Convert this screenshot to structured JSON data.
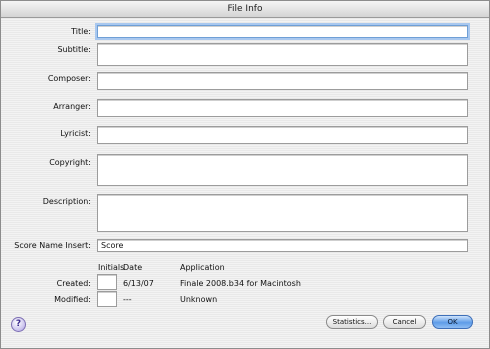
{
  "window": {
    "title": "File Info"
  },
  "fields": {
    "title": {
      "label": "Title:",
      "value": ""
    },
    "subtitle": {
      "label": "Subtitle:",
      "value": ""
    },
    "composer": {
      "label": "Composer:",
      "value": ""
    },
    "arranger": {
      "label": "Arranger:",
      "value": ""
    },
    "lyricist": {
      "label": "Lyricist:",
      "value": ""
    },
    "copyright": {
      "label": "Copyright:",
      "value": ""
    },
    "description": {
      "label": "Description:",
      "value": ""
    },
    "score_name_insert": {
      "label": "Score Name Insert:",
      "value": "Score"
    }
  },
  "history": {
    "headers": {
      "initials": "Initials",
      "date": "Date",
      "application": "Application"
    },
    "created": {
      "label": "Created:",
      "initials": "",
      "date": "6/13/07",
      "application": "Finale 2008.b34 for Macintosh"
    },
    "modified": {
      "label": "Modified:",
      "initials": "",
      "date": "---",
      "application": "Unknown"
    }
  },
  "buttons": {
    "statistics": "Statistics...",
    "cancel": "Cancel",
    "ok": "OK",
    "help_icon": "help-icon",
    "help_glyph": "?"
  }
}
